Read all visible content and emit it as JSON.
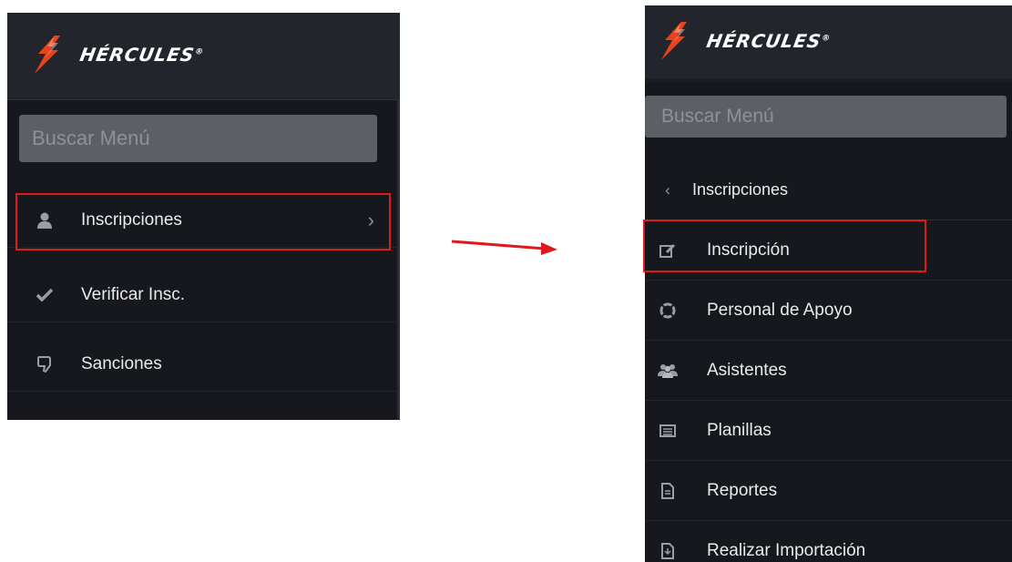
{
  "brand": {
    "name": "HÉRCULES",
    "mark": "®"
  },
  "left_panel": {
    "search_placeholder": "Buscar Menú",
    "items": [
      {
        "label": "Inscripciones",
        "icon": "user-icon",
        "chevron": "›"
      },
      {
        "label": "Verificar Insc.",
        "icon": "check-icon"
      },
      {
        "label": "Sanciones",
        "icon": "thumbs-down-icon"
      }
    ]
  },
  "right_panel": {
    "search_placeholder": "Buscar Menú",
    "back_item": {
      "label": "Inscripciones",
      "icon": "chevron-left-icon",
      "glyph": "‹"
    },
    "items": [
      {
        "label": "Inscripción",
        "icon": "edit-icon"
      },
      {
        "label": "Personal de Apoyo",
        "icon": "life-ring-icon"
      },
      {
        "label": "Asistentes",
        "icon": "users-icon"
      },
      {
        "label": "Planillas",
        "icon": "list-icon"
      },
      {
        "label": "Reportes",
        "icon": "file-icon"
      },
      {
        "label": "Realizar Importación",
        "icon": "file-import-icon"
      }
    ]
  },
  "colors": {
    "highlight": "#e0191e",
    "sidebar_bg": "#16181d",
    "header_bg": "#22262c",
    "logo_orange": "#e8431a"
  }
}
